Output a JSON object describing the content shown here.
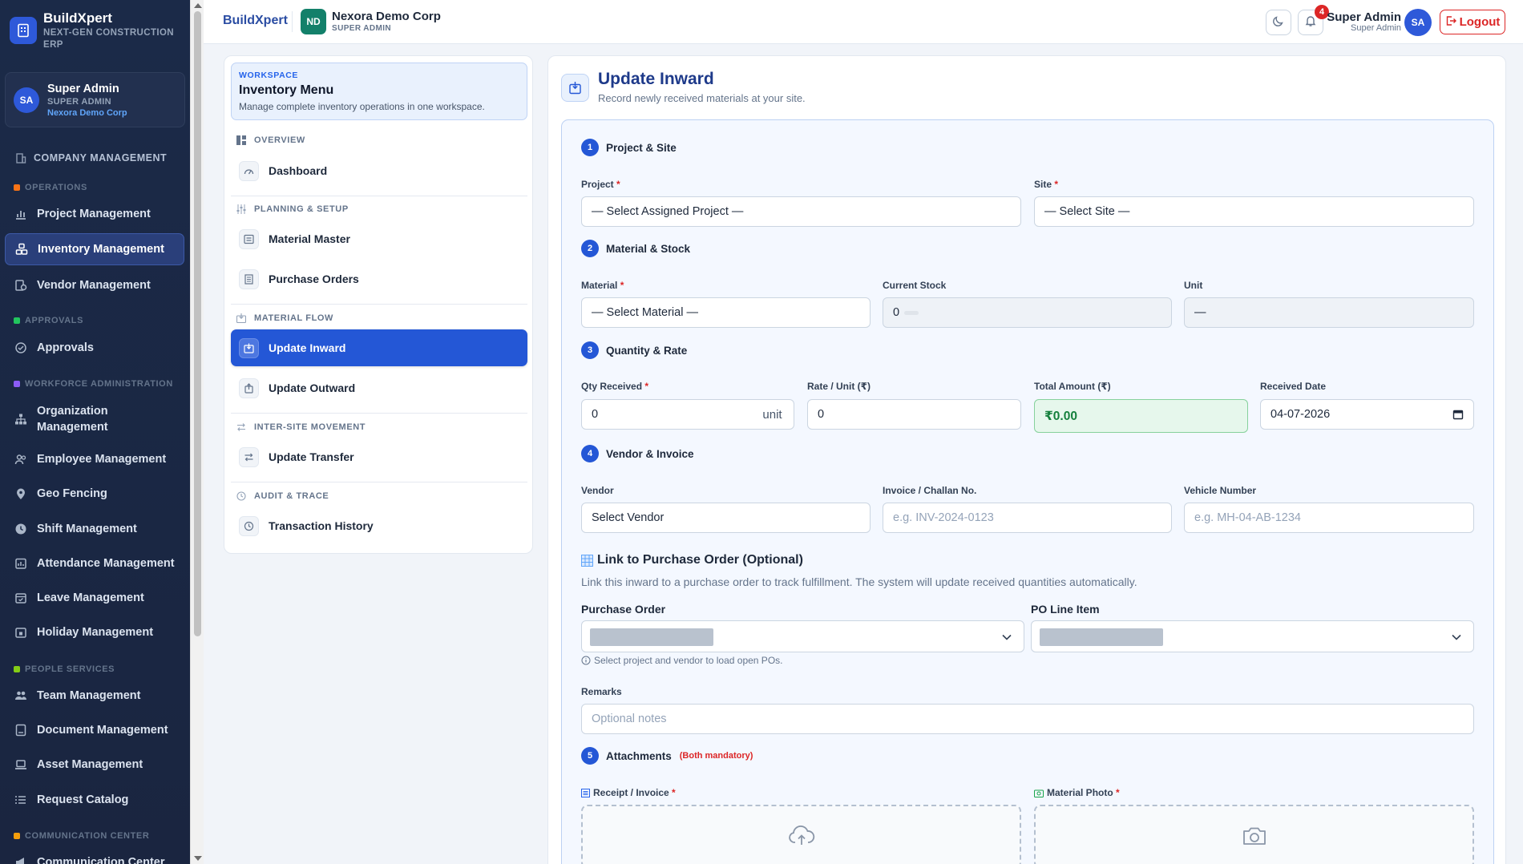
{
  "brand": {
    "name": "BuildXpert",
    "tagline": "NEXT-GEN CONSTRUCTION ERP"
  },
  "user_card": {
    "initials": "SA",
    "name": "Super Admin",
    "role": "SUPER ADMIN",
    "company": "Nexora Demo Corp"
  },
  "sidebar": {
    "company_management": "COMPANY MANAGEMENT",
    "sections": {
      "operations": "OPERATIONS",
      "approvals": "APPROVALS",
      "workforce": "WORKFORCE ADMINISTRATION",
      "people": "PEOPLE SERVICES",
      "communication": "COMMUNICATION CENTER"
    },
    "items": {
      "project": "Project Management",
      "inventory": "Inventory Management",
      "vendor": "Vendor Management",
      "approvals": "Approvals",
      "org_line1": "Organization",
      "org_line2": "Management",
      "employee": "Employee Management",
      "geo": "Geo Fencing",
      "shift": "Shift Management",
      "attendance": "Attendance Management",
      "leave": "Leave Management",
      "holiday": "Holiday Management",
      "team": "Team Management",
      "document": "Document Management",
      "asset": "Asset Management",
      "request": "Request Catalog",
      "communication": "Communication Center"
    },
    "active_item": "Inventory Management"
  },
  "topbar": {
    "brand": "BuildXpert",
    "org_initials": "ND",
    "org_name": "Nexora Demo Corp",
    "org_role": "SUPER ADMIN",
    "notification_count": "4",
    "user_name": "Super Admin",
    "user_role": "Super Admin",
    "user_initials": "SA",
    "logout": "Logout"
  },
  "inventory_menu": {
    "workspace_label": "WORKSPACE",
    "title": "Inventory Menu",
    "description": "Manage complete inventory operations in one workspace.",
    "sections": {
      "overview": "OVERVIEW",
      "planning": "PLANNING & SETUP",
      "flow": "MATERIAL FLOW",
      "intersite": "INTER-SITE MOVEMENT",
      "audit": "AUDIT & TRACE"
    },
    "items": {
      "dashboard": "Dashboard",
      "material_master": "Material Master",
      "purchase_orders": "Purchase Orders",
      "update_inward": "Update Inward",
      "update_outward": "Update Outward",
      "update_transfer": "Update Transfer",
      "transaction_history": "Transaction History"
    },
    "active_item": "Update Inward"
  },
  "form": {
    "title": "Update Inward",
    "subtitle": "Record newly received materials at your site.",
    "steps": {
      "s1": {
        "num": "1",
        "label": "Project & Site"
      },
      "s2": {
        "num": "2",
        "label": "Material & Stock"
      },
      "s3": {
        "num": "3",
        "label": "Quantity & Rate"
      },
      "s4": {
        "num": "4",
        "label": "Vendor & Invoice"
      },
      "s5": {
        "num": "5",
        "label": "Attachments",
        "note": "(Both mandatory)"
      }
    },
    "labels": {
      "project": "Project",
      "site": "Site",
      "material": "Material",
      "current_stock": "Current Stock",
      "unit": "Unit",
      "qty_received": "Qty Received",
      "rate_unit": "Rate / Unit (₹)",
      "total_amount": "Total Amount (₹)",
      "received_date": "Received Date",
      "vendor": "Vendor",
      "invoice": "Invoice / Challan No.",
      "vehicle": "Vehicle Number",
      "remarks": "Remarks",
      "receipt": "Receipt / Invoice",
      "material_photo": "Material Photo",
      "required_mark": "*"
    },
    "values": {
      "project": "— Select Assigned Project —",
      "site": "— Select Site —",
      "material": "— Select Material —",
      "current_stock": "0",
      "unit": "—",
      "qty_received": "0",
      "qty_unit": "unit",
      "rate_unit": "0",
      "total_amount": "₹0.00",
      "received_date": "04-07-2026",
      "vendor": "Select Vendor"
    },
    "placeholders": {
      "invoice": "e.g. INV-2024-0123",
      "vehicle": "e.g. MH-04-AB-1234",
      "remarks": "Optional notes"
    },
    "po": {
      "title": "Link to Purchase Order (Optional)",
      "description": "Link this inward to a purchase order to track fulfillment. The system will update received quantities automatically.",
      "purchase_order_label": "Purchase Order",
      "line_item_label": "PO Line Item",
      "hint": "Select project and vendor to load open POs."
    }
  },
  "colors": {
    "primary": "#2457d6",
    "sidebar_bg": "#1b2a48",
    "danger": "#dc2626",
    "success": "#15803d"
  }
}
